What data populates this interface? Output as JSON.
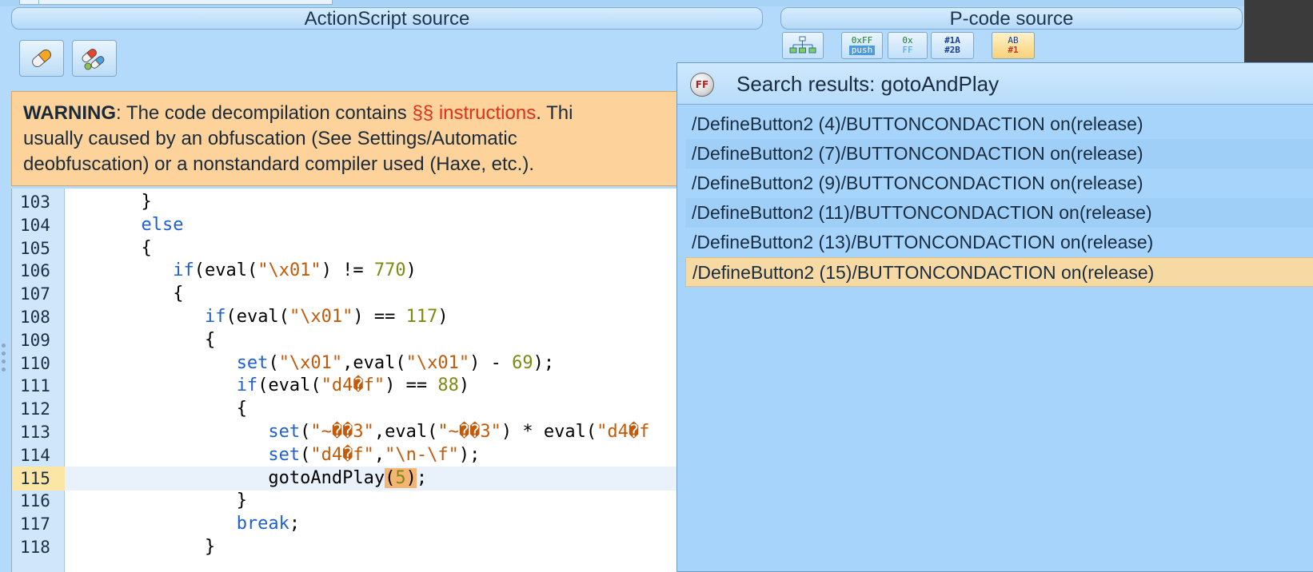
{
  "actionscript_panel": {
    "title": "ActionScript source"
  },
  "pcode_panel": {
    "title": "P-code source",
    "buttons": [
      {
        "top": "",
        "bottom": ""
      },
      {
        "top": "0xFF",
        "bottom": "push"
      },
      {
        "top": "0x",
        "bottom": "FF"
      },
      {
        "top": "#1A",
        "bottom": "#2B"
      },
      {
        "top": "AB",
        "bottom": "#1"
      }
    ]
  },
  "warning": {
    "label": "WARNING",
    "text_before": ": The code decompilation contains ",
    "highlight": "§§ instructions",
    "text_after": ". Thi",
    "line2": "usually caused by an obfuscation (See Settings/Automatic",
    "line3": "deobfuscation) or a nonstandard compiler used (Haxe, etc.)."
  },
  "code": {
    "lines": [
      {
        "n": "103",
        "indent": "      ",
        "t": [
          [
            "p",
            "}"
          ]
        ]
      },
      {
        "n": "104",
        "indent": "      ",
        "t": [
          [
            "k",
            "else"
          ]
        ]
      },
      {
        "n": "105",
        "indent": "      ",
        "t": [
          [
            "p",
            "{"
          ]
        ]
      },
      {
        "n": "106",
        "indent": "         ",
        "t": [
          [
            "k",
            "if"
          ],
          [
            "p",
            "(eval("
          ],
          [
            "s",
            "\"\\x01\""
          ],
          [
            "p",
            ") != "
          ],
          [
            "n",
            "770"
          ],
          [
            "p",
            ")"
          ]
        ]
      },
      {
        "n": "107",
        "indent": "         ",
        "t": [
          [
            "p",
            "{"
          ]
        ]
      },
      {
        "n": "108",
        "indent": "            ",
        "t": [
          [
            "k",
            "if"
          ],
          [
            "p",
            "(eval("
          ],
          [
            "s",
            "\"\\x01\""
          ],
          [
            "p",
            ") == "
          ],
          [
            "n",
            "117"
          ],
          [
            "p",
            ")"
          ]
        ]
      },
      {
        "n": "109",
        "indent": "            ",
        "t": [
          [
            "p",
            "{"
          ]
        ]
      },
      {
        "n": "110",
        "indent": "               ",
        "t": [
          [
            "k",
            "set"
          ],
          [
            "p",
            "("
          ],
          [
            "s",
            "\"\\x01\""
          ],
          [
            "p",
            ",eval("
          ],
          [
            "s",
            "\"\\x01\""
          ],
          [
            "p",
            ") - "
          ],
          [
            "n",
            "69"
          ],
          [
            "p",
            ");"
          ]
        ]
      },
      {
        "n": "111",
        "indent": "               ",
        "t": [
          [
            "k",
            "if"
          ],
          [
            "p",
            "(eval("
          ],
          [
            "s",
            "\"d4�f\""
          ],
          [
            "p",
            ") == "
          ],
          [
            "n",
            "88"
          ],
          [
            "p",
            ")"
          ]
        ]
      },
      {
        "n": "112",
        "indent": "               ",
        "t": [
          [
            "p",
            "{"
          ]
        ]
      },
      {
        "n": "113",
        "indent": "                  ",
        "t": [
          [
            "k",
            "set"
          ],
          [
            "p",
            "("
          ],
          [
            "s",
            "\"~��3\""
          ],
          [
            "p",
            ",eval("
          ],
          [
            "s",
            "\"~��3\""
          ],
          [
            "p",
            ") * eval("
          ],
          [
            "s",
            "\"d4�f"
          ]
        ]
      },
      {
        "n": "114",
        "indent": "                  ",
        "t": [
          [
            "k",
            "set"
          ],
          [
            "p",
            "("
          ],
          [
            "s",
            "\"d4�f\""
          ],
          [
            "p",
            ","
          ],
          [
            "s",
            "\"\\n-\\f\""
          ],
          [
            "p",
            ");"
          ]
        ]
      },
      {
        "n": "115",
        "indent": "                  ",
        "current": true,
        "t": [
          [
            "p",
            "gotoAndPlay"
          ],
          [
            "h",
            "("
          ],
          [
            "hn",
            "5"
          ],
          [
            "h",
            ")"
          ],
          [
            "p",
            ";"
          ]
        ]
      },
      {
        "n": "116",
        "indent": "               ",
        "t": [
          [
            "p",
            "}"
          ]
        ]
      },
      {
        "n": "117",
        "indent": "               ",
        "t": [
          [
            "k",
            "break"
          ],
          [
            "p",
            ";"
          ]
        ]
      },
      {
        "n": "118",
        "indent": "            ",
        "t": [
          [
            "p",
            "}"
          ]
        ]
      }
    ]
  },
  "search": {
    "title": "Search results: gotoAndPlay",
    "icon_label": "FF",
    "results": [
      "/DefineButton2 (4)/BUTTONCONDACTION on(release)",
      "/DefineButton2 (7)/BUTTONCONDACTION on(release)",
      "/DefineButton2 (9)/BUTTONCONDACTION on(release)",
      "/DefineButton2 (11)/BUTTONCONDACTION on(release)",
      "/DefineButton2 (13)/BUTTONCONDACTION on(release)",
      "/DefineButton2 (15)/BUTTONCONDACTION on(release)"
    ],
    "selected_index": 5
  }
}
